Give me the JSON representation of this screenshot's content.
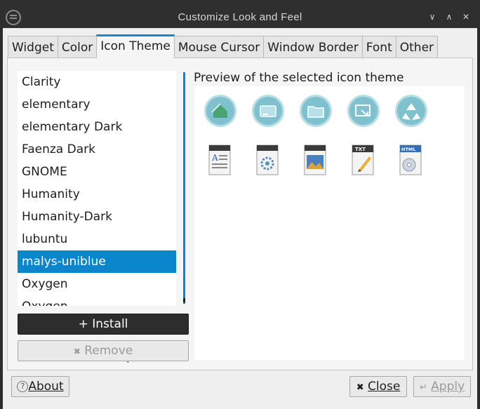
{
  "window": {
    "title": "Customize Look and Feel",
    "minimize_glyph": "∨",
    "maximize_glyph": "∧",
    "close_glyph": "✕"
  },
  "tabs": [
    {
      "label": "Widget"
    },
    {
      "label": "Color"
    },
    {
      "label": "Icon Theme",
      "active": true
    },
    {
      "label": "Mouse Cursor"
    },
    {
      "label": "Window Border"
    },
    {
      "label": "Font"
    },
    {
      "label": "Other"
    }
  ],
  "theme_list": {
    "items": [
      {
        "label": "Clarity"
      },
      {
        "label": "elementary"
      },
      {
        "label": "elementary Dark"
      },
      {
        "label": "Faenza Dark"
      },
      {
        "label": "GNOME"
      },
      {
        "label": "Humanity"
      },
      {
        "label": "Humanity-Dark"
      },
      {
        "label": "lubuntu"
      },
      {
        "label": "malys-uniblue",
        "selected": true
      },
      {
        "label": "Oxygen"
      },
      {
        "label": "Oxygen"
      }
    ]
  },
  "buttons": {
    "install_icon": "+",
    "install_label": "Install",
    "remove_icon": "✖",
    "remove_label": "Remove",
    "about_icon": "?",
    "about_label": "About",
    "close_icon": "✖",
    "close_label": "Close",
    "apply_icon": "↵",
    "apply_label": "Apply"
  },
  "preview": {
    "label": "Preview of the selected icon theme",
    "icons_row1": [
      "home-folder-icon",
      "drive-icon",
      "folder-icon",
      "shortcut-icon",
      "trash-icon"
    ],
    "icons_row2": [
      "text-document-icon",
      "settings-file-icon",
      "image-file-icon",
      "txt-file-icon",
      "html-file-icon"
    ],
    "txt_badge": "TXT",
    "html_badge": "HTML"
  },
  "colors": {
    "accent": "#0a86cd",
    "icon_teal": "#7fc1cf"
  }
}
